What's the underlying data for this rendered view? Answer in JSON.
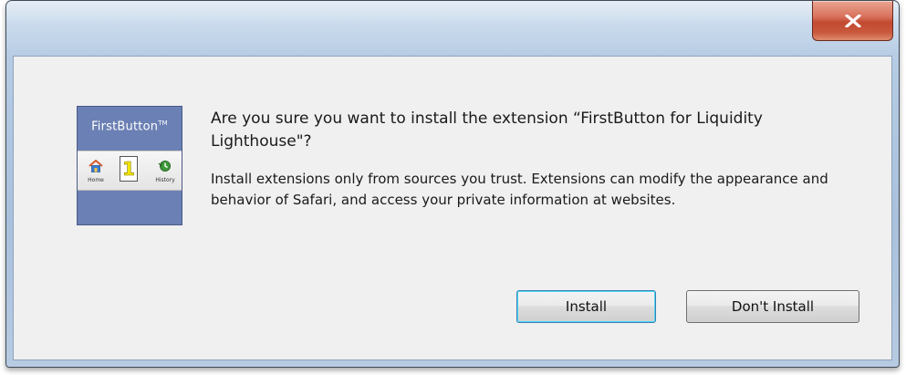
{
  "window": {
    "close_glyph": "x"
  },
  "extension": {
    "brand": "FirstButton",
    "trademark": "TM",
    "home_label": "Home",
    "one_label": "1",
    "history_label": "History"
  },
  "dialog": {
    "question": "Are you sure you want to install the extension “FirstButton for Liquidity Lighthouse\"?",
    "info": "Install extensions only from sources you trust. Extensions can modify the appearance and behavior of Safari, and access your private information at websites."
  },
  "buttons": {
    "install_label": "Install",
    "dont_install_label": "Don't Install"
  },
  "colors": {
    "accent": "#3c7fb1",
    "close_red": "#c24a31",
    "icon_blue": "#6b80b4"
  }
}
